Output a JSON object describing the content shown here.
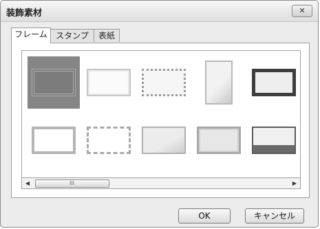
{
  "window": {
    "title": "装飾素材",
    "close_label": "✕"
  },
  "tabs": [
    {
      "label": "フレーム",
      "active": true
    },
    {
      "label": "スタンプ",
      "active": false
    },
    {
      "label": "表紙",
      "active": false
    }
  ],
  "gallery": {
    "items": [
      {
        "name": "frame-1",
        "selected": true
      },
      {
        "name": "frame-2",
        "selected": false
      },
      {
        "name": "frame-3",
        "selected": false
      },
      {
        "name": "frame-4",
        "selected": false
      },
      {
        "name": "frame-5",
        "selected": false
      },
      {
        "name": "frame-6",
        "selected": false
      },
      {
        "name": "frame-7",
        "selected": false
      },
      {
        "name": "frame-8",
        "selected": false
      },
      {
        "name": "frame-9",
        "selected": false
      },
      {
        "name": "frame-10",
        "selected": false
      }
    ]
  },
  "scrollbar": {
    "left_arrow": "◀",
    "right_arrow": "▶",
    "grip": "III"
  },
  "buttons": {
    "ok_label": "OK",
    "cancel_label": "キャンセル"
  }
}
